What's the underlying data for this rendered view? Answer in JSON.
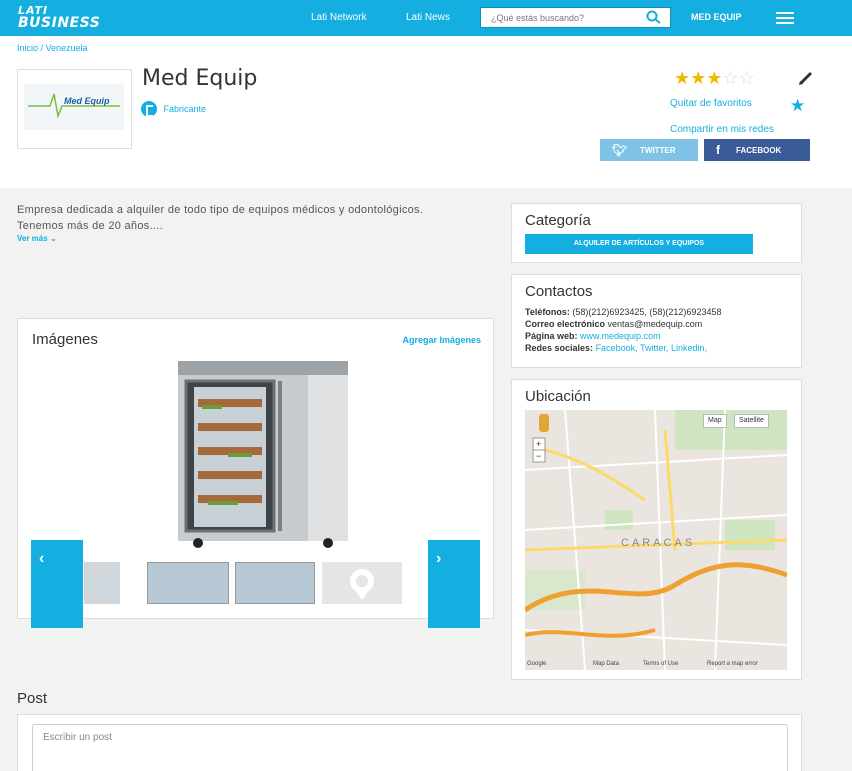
{
  "header": {
    "logo_line1": "LATI",
    "logo_line2": "BUSINESS",
    "nav_network": "Lati Network",
    "nav_news": "Lati News",
    "search_placeholder": "¿Qué estás buscando?",
    "user_name": "MED EQUIP"
  },
  "breadcrumb": "Inicio / Venezuela",
  "company": {
    "name": "Med Equip",
    "role": "Fabricante",
    "rating": 3,
    "rating_max": 5,
    "favorite_label": "Quitar de favoritos",
    "share_label": "Compartir en mis redes",
    "twitter_label": "TWITTER",
    "facebook_label": "FACEBOOK",
    "logo_text": "Med Equip"
  },
  "description": {
    "text": "Empresa dedicada a alquiler de todo tipo de equipos médicos y odontológicos. Tenemos más de 20 años....",
    "see_more": "Ver más"
  },
  "images": {
    "title": "Imágenes",
    "add_label": "Agregar Imágenes"
  },
  "category": {
    "title": "Categoría",
    "badge": "ALQUILER DE ARTÍCULOS Y EQUIPOS"
  },
  "contacts": {
    "title": "Contactos",
    "phones_label": "Teléfonos:",
    "phones_value": "(58)(212)6923425, (58)(212)6923458",
    "email_label": "Correo electrónico",
    "email_value": "ventas@medequip.com",
    "web_label": "Página web:",
    "web_value": "www.medequip.com",
    "social_label": "Redes sociales:",
    "social_facebook": "Facebook,",
    "social_twitter": "Twitter,",
    "social_linkedin": "Linkedin,"
  },
  "location": {
    "title": "Ubicación",
    "map_btn": "Map",
    "satellite_btn": "Satellite",
    "map_city": "CARACAS",
    "footer_google": "Google",
    "footer_data": "Map Data",
    "footer_terms": "Terms of Use",
    "footer_report": "Report a map error"
  },
  "post": {
    "title": "Post",
    "placeholder": "Escribir un post"
  },
  "colors": {
    "accent": "#14aee0",
    "twitter": "#7fc2e6",
    "facebook": "#3b5a98",
    "star_on": "#f5b800"
  }
}
